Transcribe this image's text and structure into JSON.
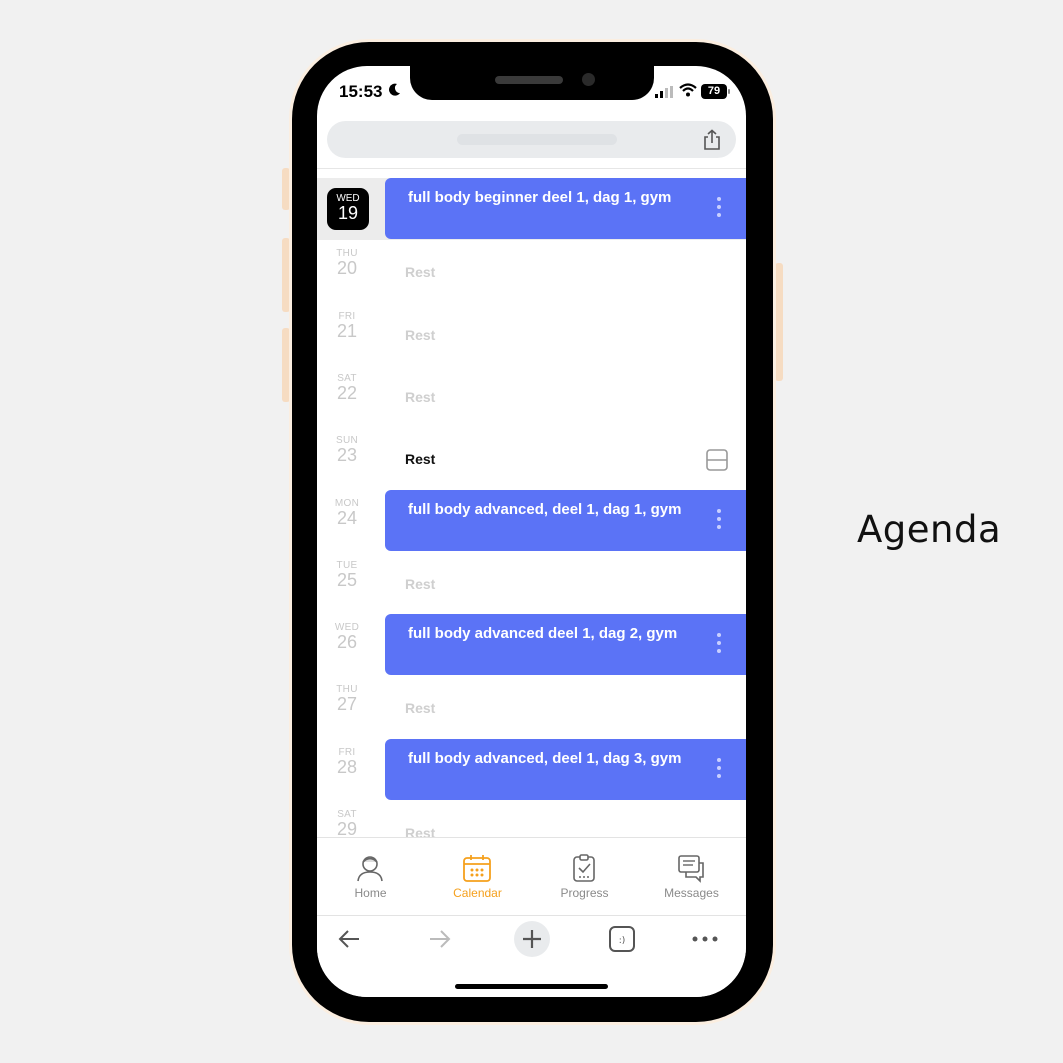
{
  "caption": "Agenda",
  "status_bar": {
    "time": "15:53",
    "battery": "79"
  },
  "agenda": {
    "days": [
      {
        "dow": "WED",
        "num": "19",
        "today": true,
        "workout": "full body beginner deel 1, dag 1, gym"
      },
      {
        "dow": "THU",
        "num": "20",
        "rest": "Rest"
      },
      {
        "dow": "FRI",
        "num": "21",
        "rest": "Rest"
      },
      {
        "dow": "SAT",
        "num": "22",
        "rest": "Rest"
      },
      {
        "dow": "SUN",
        "num": "23",
        "rest": "Rest",
        "rest_active": true
      },
      {
        "dow": "MON",
        "num": "24",
        "workout": "full body advanced, deel 1, dag 1, gym"
      },
      {
        "dow": "TUE",
        "num": "25",
        "rest": "Rest"
      },
      {
        "dow": "WED",
        "num": "26",
        "workout": "full body advanced deel 1, dag 2, gym"
      },
      {
        "dow": "THU",
        "num": "27",
        "rest": "Rest"
      },
      {
        "dow": "FRI",
        "num": "28",
        "workout": "full body advanced, deel 1, dag 3, gym"
      },
      {
        "dow": "SAT",
        "num": "29",
        "rest": "Rest"
      }
    ]
  },
  "tabbar": {
    "home": "Home",
    "calendar": "Calendar",
    "progress": "Progress",
    "messages": "Messages",
    "active": "calendar",
    "accent_color": "#f5a01d"
  },
  "colors": {
    "workout": "#5b73f6",
    "rest_inactive": "#cfcfcf"
  },
  "icons": [
    "back-arrow-icon",
    "forward-arrow-icon",
    "plus-icon",
    "tabs-icon",
    "more-icon",
    "share-icon"
  ]
}
